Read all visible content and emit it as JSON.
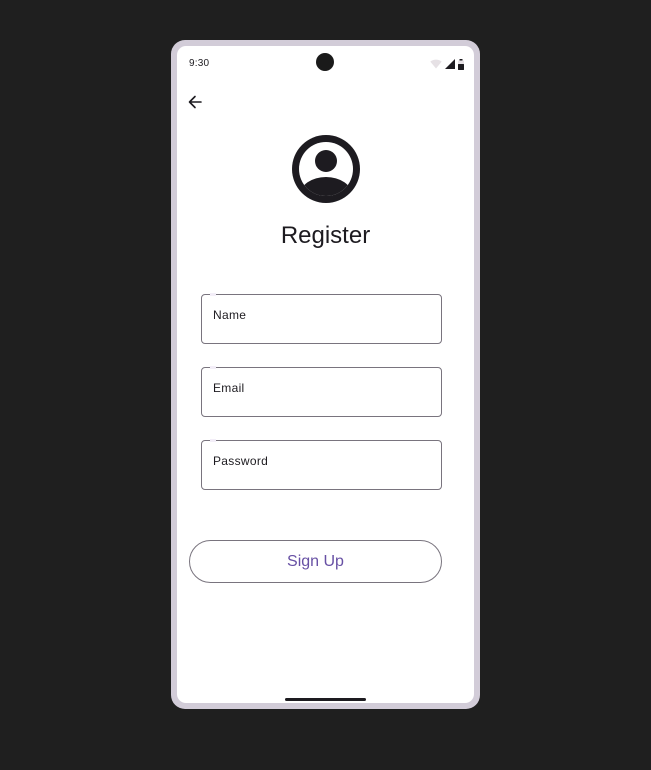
{
  "status_bar": {
    "time": "9:30",
    "icons": [
      "wifi-icon",
      "signal-icon",
      "battery-icon"
    ]
  },
  "navigation": {
    "back_icon": "arrow-back-icon"
  },
  "header": {
    "avatar_icon": "account-circle-icon",
    "title": "Register"
  },
  "form": {
    "name_field": {
      "label": "Name",
      "value": ""
    },
    "email_field": {
      "label": "Email",
      "value": ""
    },
    "password_field": {
      "label": "Password",
      "value": ""
    }
  },
  "actions": {
    "signup_label": "Sign Up"
  },
  "colors": {
    "background": "#1f1f1f",
    "frame": "#d2ccd8",
    "surface": "#ffffff",
    "on_surface": "#1d1b20",
    "outline": "#79747e",
    "primary": "#6750a4"
  }
}
